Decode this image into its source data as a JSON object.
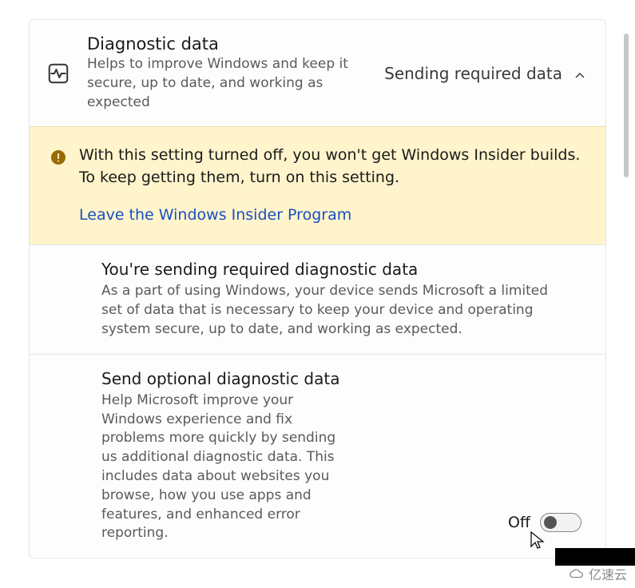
{
  "diagnostic": {
    "title": "Diagnostic data",
    "desc": "Helps to improve Windows and keep it secure, up to date, and working as expected",
    "status": "Sending required data"
  },
  "warning": {
    "text": "With this setting turned off, you won't get Windows Insider builds. To keep getting them, turn on this setting.",
    "link_label": "Leave the Windows Insider Program"
  },
  "required_section": {
    "title": "You're sending required diagnostic data",
    "desc": "As a part of using Windows, your device sends Microsoft a limited set of data that is necessary to keep your device and operating system secure, up to date, and working as expected."
  },
  "optional_section": {
    "title": "Send optional diagnostic data",
    "desc": "Help Microsoft improve your Windows experience and fix problems more quickly by sending us additional diagnostic data. This includes data about websites you browse, how you use apps and features, and enhanced error reporting.",
    "toggle_label": "Off",
    "toggle_state": false
  },
  "watermark": "亿速云"
}
